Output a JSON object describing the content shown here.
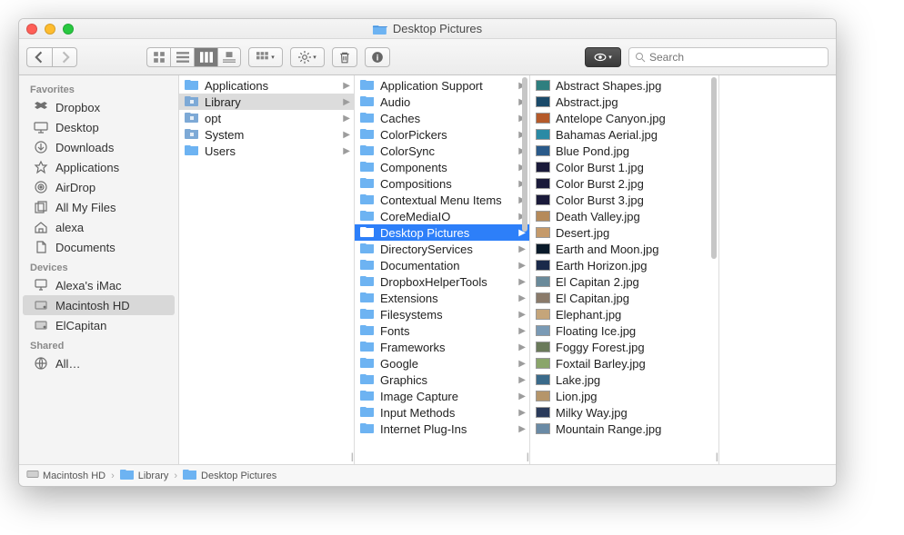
{
  "window": {
    "title": "Desktop Pictures"
  },
  "search": {
    "placeholder": "Search"
  },
  "sidebar": {
    "sections": [
      {
        "label": "Favorites",
        "items": [
          {
            "label": "Dropbox",
            "icon": "dropbox"
          },
          {
            "label": "Desktop",
            "icon": "desktop"
          },
          {
            "label": "Downloads",
            "icon": "downloads"
          },
          {
            "label": "Applications",
            "icon": "applications"
          },
          {
            "label": "AirDrop",
            "icon": "airdrop"
          },
          {
            "label": "All My Files",
            "icon": "allfiles"
          },
          {
            "label": "alexa",
            "icon": "home"
          },
          {
            "label": "Documents",
            "icon": "documents"
          }
        ]
      },
      {
        "label": "Devices",
        "items": [
          {
            "label": "Alexa's iMac",
            "icon": "imac"
          },
          {
            "label": "Macintosh HD",
            "icon": "hdd",
            "selected": true
          },
          {
            "label": "ElCapitan",
            "icon": "hdd"
          }
        ]
      },
      {
        "label": "Shared",
        "items": [
          {
            "label": "All…",
            "icon": "globe"
          }
        ]
      }
    ]
  },
  "columns": [
    {
      "items": [
        {
          "label": "Applications",
          "type": "folder",
          "arrow": true
        },
        {
          "label": "Library",
          "type": "folder-sys",
          "arrow": true,
          "selected": "light"
        },
        {
          "label": "opt",
          "type": "folder-sys",
          "arrow": true
        },
        {
          "label": "System",
          "type": "folder-sys",
          "arrow": true
        },
        {
          "label": "Users",
          "type": "folder",
          "arrow": true
        }
      ]
    },
    {
      "items": [
        {
          "label": "Application Support",
          "type": "folder",
          "arrow": true
        },
        {
          "label": "Audio",
          "type": "folder",
          "arrow": true
        },
        {
          "label": "Caches",
          "type": "folder",
          "arrow": true
        },
        {
          "label": "ColorPickers",
          "type": "folder",
          "arrow": true
        },
        {
          "label": "ColorSync",
          "type": "folder",
          "arrow": true
        },
        {
          "label": "Components",
          "type": "folder",
          "arrow": true
        },
        {
          "label": "Compositions",
          "type": "folder",
          "arrow": true
        },
        {
          "label": "Contextual Menu Items",
          "type": "folder",
          "arrow": true
        },
        {
          "label": "CoreMediaIO",
          "type": "folder",
          "arrow": true
        },
        {
          "label": "Desktop Pictures",
          "type": "folder",
          "arrow": true,
          "selected": "blue"
        },
        {
          "label": "DirectoryServices",
          "type": "folder",
          "arrow": true
        },
        {
          "label": "Documentation",
          "type": "folder",
          "arrow": true
        },
        {
          "label": "DropboxHelperTools",
          "type": "folder",
          "arrow": true
        },
        {
          "label": "Extensions",
          "type": "folder",
          "arrow": true
        },
        {
          "label": "Filesystems",
          "type": "folder",
          "arrow": true
        },
        {
          "label": "Fonts",
          "type": "folder",
          "arrow": true
        },
        {
          "label": "Frameworks",
          "type": "folder",
          "arrow": true
        },
        {
          "label": "Google",
          "type": "folder",
          "arrow": true
        },
        {
          "label": "Graphics",
          "type": "folder",
          "arrow": true
        },
        {
          "label": "Image Capture",
          "type": "folder",
          "arrow": true
        },
        {
          "label": "Input Methods",
          "type": "folder",
          "arrow": true
        },
        {
          "label": "Internet Plug-Ins",
          "type": "folder",
          "arrow": true
        }
      ]
    },
    {
      "items": [
        {
          "label": "Abstract Shapes.jpg",
          "type": "image",
          "color": "#2f7f7f"
        },
        {
          "label": "Abstract.jpg",
          "type": "image",
          "color": "#1a4a6a"
        },
        {
          "label": "Antelope Canyon.jpg",
          "type": "image",
          "color": "#b55a2a"
        },
        {
          "label": "Bahamas Aerial.jpg",
          "type": "image",
          "color": "#2a8aa5"
        },
        {
          "label": "Blue Pond.jpg",
          "type": "image",
          "color": "#2a5a8a"
        },
        {
          "label": "Color Burst 1.jpg",
          "type": "image",
          "color": "#1a1a3a"
        },
        {
          "label": "Color Burst 2.jpg",
          "type": "image",
          "color": "#1a1a3a"
        },
        {
          "label": "Color Burst 3.jpg",
          "type": "image",
          "color": "#1a1a3a"
        },
        {
          "label": "Death Valley.jpg",
          "type": "image",
          "color": "#b58a5a"
        },
        {
          "label": "Desert.jpg",
          "type": "image",
          "color": "#c59a6a"
        },
        {
          "label": "Earth and Moon.jpg",
          "type": "image",
          "color": "#0a1a2a"
        },
        {
          "label": "Earth Horizon.jpg",
          "type": "image",
          "color": "#1a2a4a"
        },
        {
          "label": "El Capitan 2.jpg",
          "type": "image",
          "color": "#6a8a9a"
        },
        {
          "label": "El Capitan.jpg",
          "type": "image",
          "color": "#8a7a6a"
        },
        {
          "label": "Elephant.jpg",
          "type": "image",
          "color": "#c5a57a"
        },
        {
          "label": "Floating Ice.jpg",
          "type": "image",
          "color": "#7a9ab5"
        },
        {
          "label": "Foggy Forest.jpg",
          "type": "image",
          "color": "#6a7a5a"
        },
        {
          "label": "Foxtail Barley.jpg",
          "type": "image",
          "color": "#8aa56a"
        },
        {
          "label": "Lake.jpg",
          "type": "image",
          "color": "#3a6a8a"
        },
        {
          "label": "Lion.jpg",
          "type": "image",
          "color": "#b5956a"
        },
        {
          "label": "Milky Way.jpg",
          "type": "image",
          "color": "#2a3a5a"
        },
        {
          "label": "Mountain Range.jpg",
          "type": "image",
          "color": "#6a8aa5"
        }
      ]
    }
  ],
  "pathbar": [
    {
      "label": "Macintosh HD",
      "icon": "hdd"
    },
    {
      "label": "Library",
      "icon": "folder"
    },
    {
      "label": "Desktop Pictures",
      "icon": "folder"
    }
  ]
}
